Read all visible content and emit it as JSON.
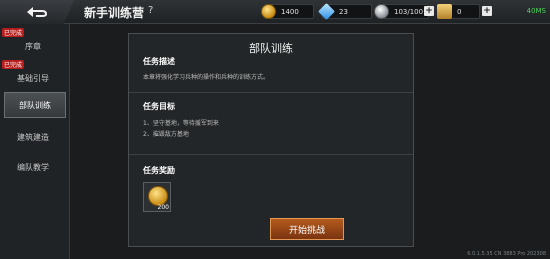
{
  "header": {
    "title": "新手训练营",
    "help": "?"
  },
  "resources": {
    "gold": "1400",
    "gems": "23",
    "energy": "103/100",
    "badges": "0",
    "signal": "40MS"
  },
  "sidebar": {
    "items": [
      {
        "label": "序章",
        "badge": "已完成"
      },
      {
        "label": "基础引导",
        "badge": "已完成"
      },
      {
        "label": "部队训练",
        "badge": ""
      },
      {
        "label": "建筑建造",
        "badge": ""
      },
      {
        "label": "编队教学",
        "badge": ""
      }
    ]
  },
  "panel": {
    "title": "部队训练",
    "desc_head": "任务描述",
    "desc_text": "本章将强化学习兵种的操作和兵种的训练方式。",
    "goal_head": "任务目标",
    "goals": [
      "1、坚守基地，等待援军到来",
      "2、摧毁敌方基地"
    ],
    "reward_head": "任务奖励",
    "reward_amount": "200",
    "start_label": "开始挑战"
  },
  "footer": {
    "version": "6.0.1.5.35 CN 3883 Pro 202308"
  },
  "colors": {
    "accent": "#b45a1d",
    "badge_red": "#b71d1d",
    "signal_green": "#4bd15a"
  }
}
